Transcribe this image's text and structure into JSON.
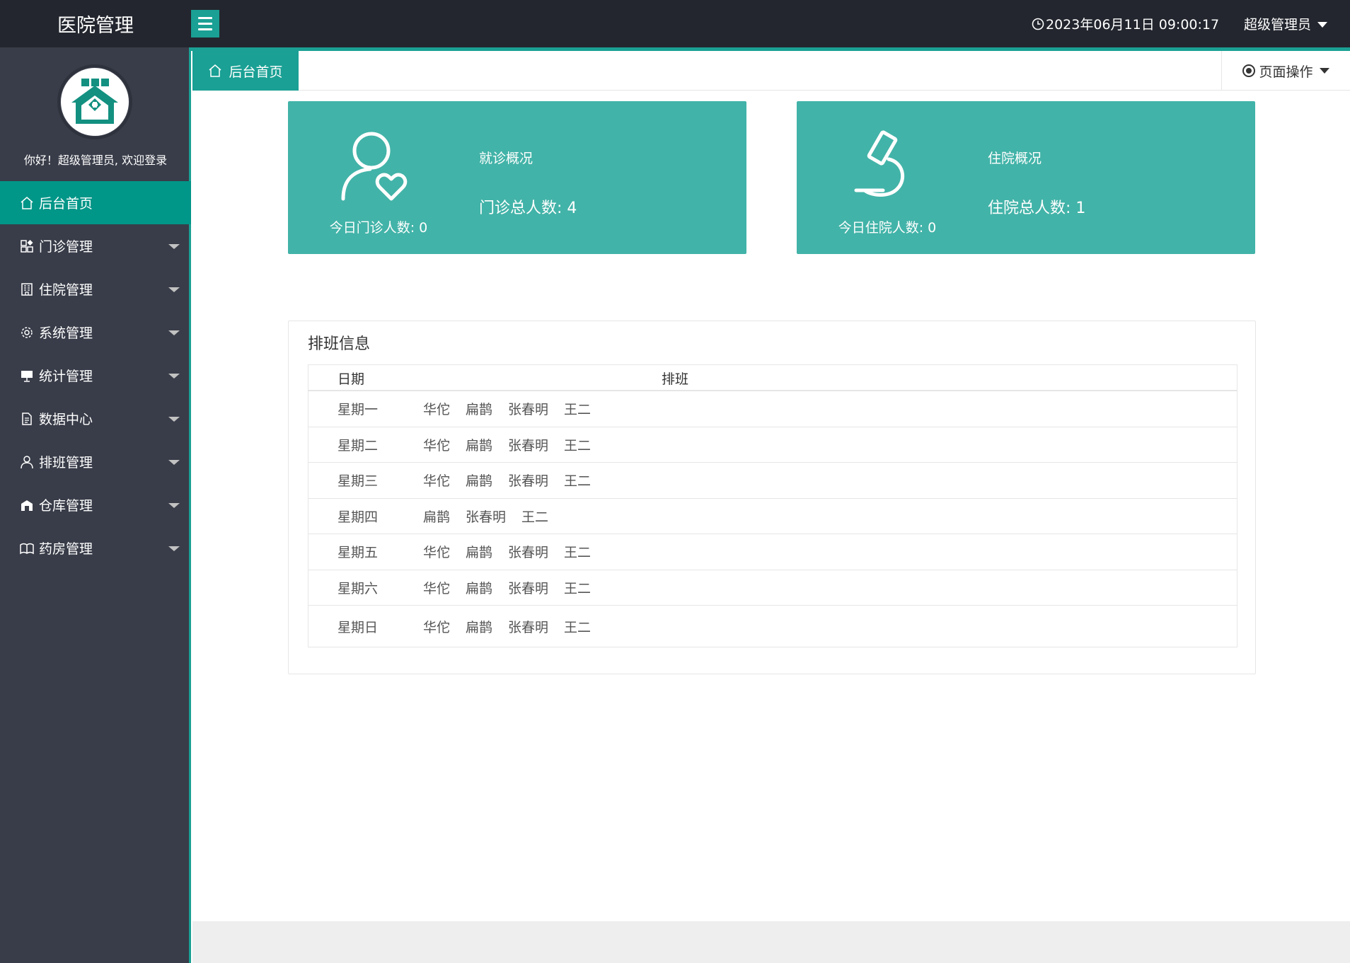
{
  "app": {
    "brand": "医院管理",
    "datetime": "2023年06月11日 09:00:17",
    "user": "超级管理员"
  },
  "sidebar": {
    "welcome": "你好！超级管理员, 欢迎登录",
    "items": [
      {
        "label": "后台首页",
        "icon": "home-icon",
        "active": true
      },
      {
        "label": "门诊管理",
        "icon": "apps-icon"
      },
      {
        "label": "住院管理",
        "icon": "building-icon"
      },
      {
        "label": "系统管理",
        "icon": "gear-icon"
      },
      {
        "label": "统计管理",
        "icon": "monitor-icon"
      },
      {
        "label": "数据中心",
        "icon": "document-icon"
      },
      {
        "label": "排班管理",
        "icon": "user-icon"
      },
      {
        "label": "仓库管理",
        "icon": "warehouse-icon"
      },
      {
        "label": "药房管理",
        "icon": "book-icon"
      }
    ]
  },
  "tabs": {
    "home": "后台首页",
    "page_ops": "页面操作"
  },
  "cards": {
    "outpatient": {
      "title": "就诊概况",
      "total": "门诊总人数: 4",
      "today": "今日门诊人数: 0"
    },
    "inpatient": {
      "title": "住院概况",
      "total": "住院总人数: 1",
      "today": "今日住院人数: 0"
    }
  },
  "schedule": {
    "title": "排班信息",
    "headers": {
      "date": "日期",
      "shift": "排班"
    },
    "rows": [
      {
        "day": "星期一",
        "names": [
          "华佗",
          "扁鹊",
          "张春明",
          "王二"
        ]
      },
      {
        "day": "星期二",
        "names": [
          "华佗",
          "扁鹊",
          "张春明",
          "王二"
        ]
      },
      {
        "day": "星期三",
        "names": [
          "华佗",
          "扁鹊",
          "张春明",
          "王二"
        ]
      },
      {
        "day": "星期四",
        "names": [
          "扁鹊",
          "张春明",
          "王二"
        ]
      },
      {
        "day": "星期五",
        "names": [
          "华佗",
          "扁鹊",
          "张春明",
          "王二"
        ]
      },
      {
        "day": "星期六",
        "names": [
          "华佗",
          "扁鹊",
          "张春明",
          "王二"
        ]
      },
      {
        "day": "星期日",
        "names": [
          "华佗",
          "扁鹊",
          "张春明",
          "王二"
        ]
      }
    ]
  },
  "colors": {
    "accent": "#1aa094",
    "active_nav": "#009688",
    "card": "#42b3a8",
    "topbar": "#23262e",
    "sidebar": "#393d49"
  }
}
